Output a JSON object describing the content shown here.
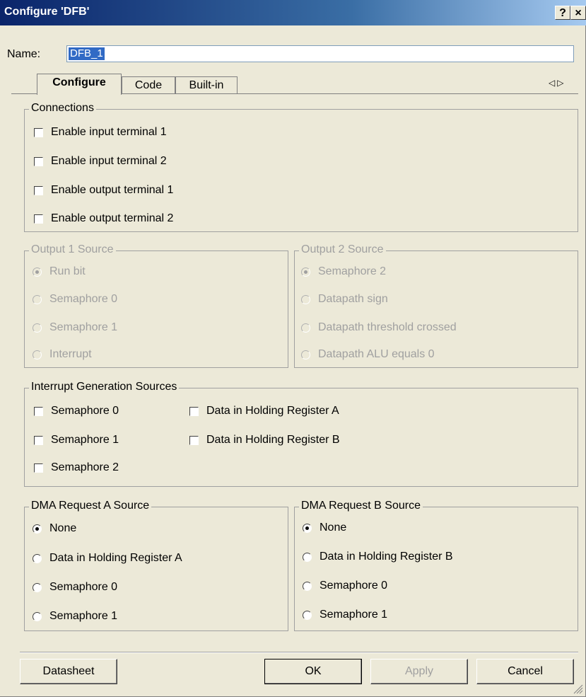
{
  "window": {
    "title": "Configure 'DFB'",
    "help_button": "?",
    "close_button": "×"
  },
  "name": {
    "label": "Name:",
    "value": "DFB_1"
  },
  "tabs": [
    {
      "label": "Configure",
      "active": true
    },
    {
      "label": "Code",
      "active": false
    },
    {
      "label": "Built-in",
      "active": false
    }
  ],
  "tab_scroll": {
    "left": "◁",
    "right": "▷"
  },
  "connections": {
    "title": "Connections",
    "items": [
      {
        "label": "Enable input terminal 1",
        "checked": false
      },
      {
        "label": "Enable input terminal 2",
        "checked": false
      },
      {
        "label": "Enable output terminal 1",
        "checked": false
      },
      {
        "label": "Enable output terminal 2",
        "checked": false
      }
    ]
  },
  "output1": {
    "title": "Output 1 Source",
    "enabled": false,
    "options": [
      {
        "label": "Run bit",
        "selected": true
      },
      {
        "label": "Semaphore 0",
        "selected": false
      },
      {
        "label": "Semaphore 1",
        "selected": false
      },
      {
        "label": "Interrupt",
        "selected": false
      }
    ]
  },
  "output2": {
    "title": "Output 2 Source",
    "enabled": false,
    "options": [
      {
        "label": "Semaphore 2",
        "selected": true
      },
      {
        "label": "Datapath sign",
        "selected": false
      },
      {
        "label": "Datapath threshold crossed",
        "selected": false
      },
      {
        "label": "Datapath ALU equals 0",
        "selected": false
      }
    ]
  },
  "interrupt": {
    "title": "Interrupt Generation Sources",
    "items": [
      {
        "label": "Semaphore 0",
        "checked": false
      },
      {
        "label": "Semaphore 1",
        "checked": false
      },
      {
        "label": "Semaphore 2",
        "checked": false
      },
      {
        "label": "Data in Holding Register A",
        "checked": false
      },
      {
        "label": "Data in Holding Register B",
        "checked": false
      }
    ]
  },
  "dma_a": {
    "title": "DMA Request A Source",
    "options": [
      {
        "label": "None",
        "selected": true
      },
      {
        "label": "Data in Holding Register A",
        "selected": false
      },
      {
        "label": "Semaphore 0",
        "selected": false
      },
      {
        "label": "Semaphore 1",
        "selected": false
      }
    ]
  },
  "dma_b": {
    "title": "DMA Request B Source",
    "options": [
      {
        "label": "None",
        "selected": true
      },
      {
        "label": "Data in Holding Register B",
        "selected": false
      },
      {
        "label": "Semaphore 0",
        "selected": false
      },
      {
        "label": "Semaphore 1",
        "selected": false
      }
    ]
  },
  "buttons": {
    "datasheet": "Datasheet",
    "ok": "OK",
    "apply": "Apply",
    "cancel": "Cancel"
  },
  "apply_enabled": false
}
